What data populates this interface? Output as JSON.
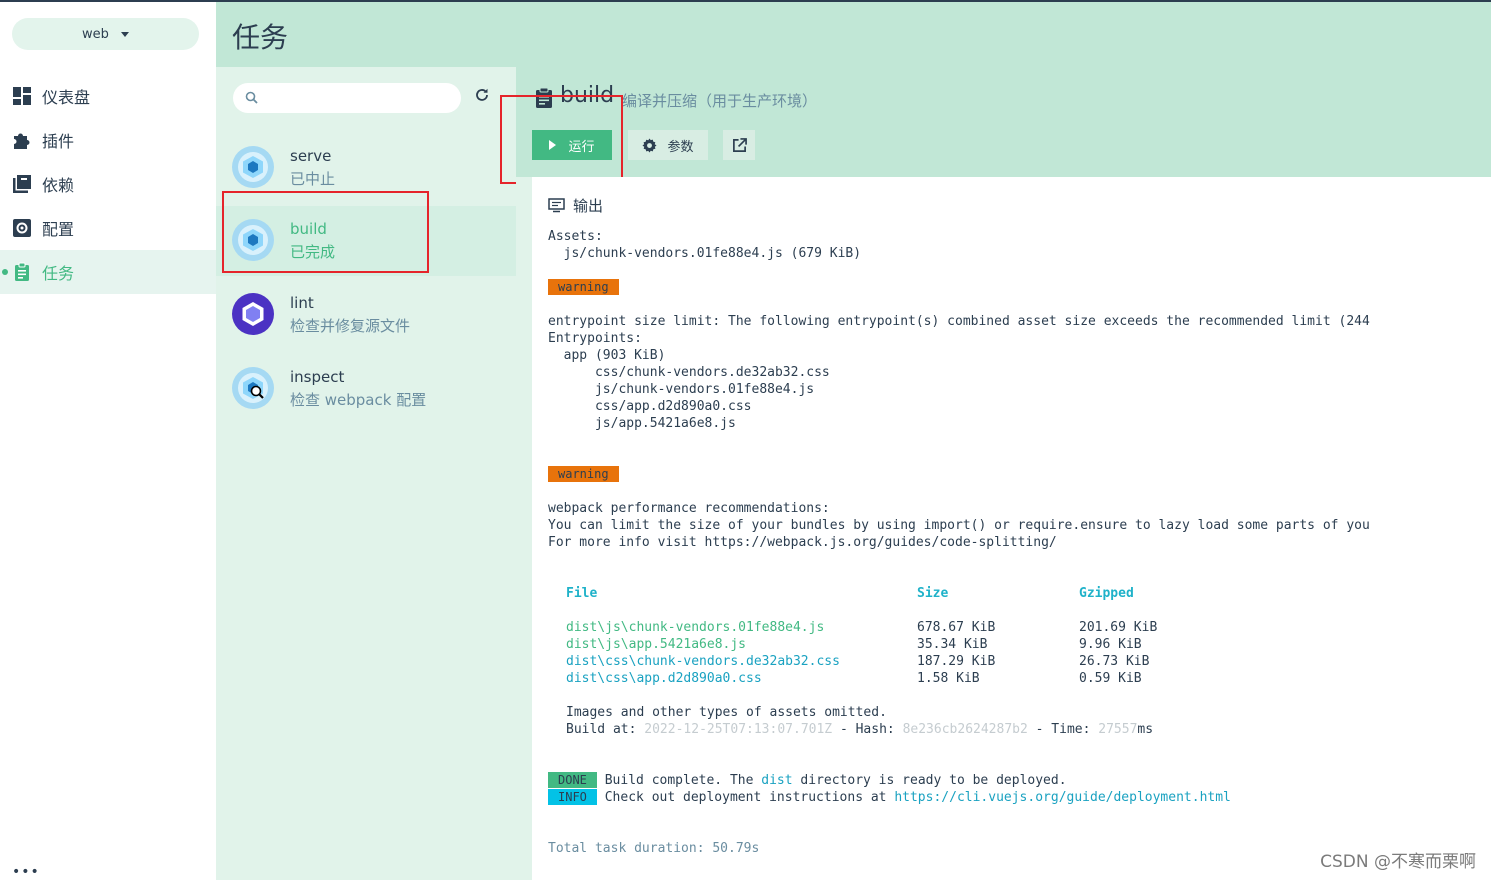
{
  "project": {
    "name": "web"
  },
  "nav": {
    "items": [
      {
        "label": "仪表盘",
        "icon": "dashboard-icon"
      },
      {
        "label": "插件",
        "icon": "puzzle-icon"
      },
      {
        "label": "依赖",
        "icon": "library-icon"
      },
      {
        "label": "配置",
        "icon": "settings-icon"
      },
      {
        "label": "任务",
        "icon": "clipboard-icon",
        "active": true
      }
    ],
    "more": "•••"
  },
  "header": {
    "title": "任务"
  },
  "search": {
    "placeholder": ""
  },
  "tasks": [
    {
      "name": "serve",
      "description": "已中止"
    },
    {
      "name": "build",
      "description": "已完成",
      "selected": true
    },
    {
      "name": "lint",
      "description": "检查并修复源文件"
    },
    {
      "name": "inspect",
      "description": "检查 webpack 配置"
    }
  ],
  "detail": {
    "name": "build",
    "description": "编译并压缩（用于生产环境）",
    "run_label": "运行",
    "params_label": "参数",
    "output_title": "输出"
  },
  "log": {
    "assets": "Assets:\n  js/chunk-vendors.01fe88e4.js (679 KiB)",
    "warning1": "warning",
    "entrypoint": "entrypoint size limit: The following entrypoint(s) combined asset size exceeds the recommended limit (244\nEntrypoints:\n  app (903 KiB)\n      css/chunk-vendors.de32ab32.css\n      js/chunk-vendors.01fe88e4.js\n      css/app.d2d890a0.css\n      js/app.5421a6e8.js",
    "warning2": "warning",
    "perf": "webpack performance recommendations:\nYou can limit the size of your bundles by using import() or require.ensure to lazy load some parts of you\nFor more info visit https://webpack.js.org/guides/code-splitting/",
    "table": {
      "headers": [
        "File",
        "Size",
        "Gzipped"
      ],
      "rows": [
        {
          "file": "dist\\js\\chunk-vendors.01fe88e4.js",
          "size": "678.67 KiB",
          "gzip": "201.69 KiB",
          "kind": "js"
        },
        {
          "file": "dist\\js\\app.5421a6e8.js",
          "size": "35.34 KiB",
          "gzip": "9.96 KiB",
          "kind": "js"
        },
        {
          "file": "dist\\css\\chunk-vendors.de32ab32.css",
          "size": "187.29 KiB",
          "gzip": "26.73 KiB",
          "kind": "css"
        },
        {
          "file": "dist\\css\\app.d2d890a0.css",
          "size": "1.58 KiB",
          "gzip": "0.59 KiB",
          "kind": "css"
        }
      ]
    },
    "omitted": "Images and other types of assets omitted.",
    "build_at_label": "Build at: ",
    "build_at": "2022-12-25T07:13:07.701Z",
    "hash_label": " - Hash: ",
    "hash": "8e236cb2624287b2",
    "time_label": " - Time: ",
    "time": "27557",
    "time_unit": "ms",
    "done_badge": "DONE",
    "done_pre": "Build complete. The ",
    "done_dist": "dist",
    "done_post": " directory is ready to be deployed.",
    "info_badge": "INFO",
    "info_pre": "Check out deployment instructions at ",
    "info_url": "https://cli.vuejs.org/guide/deployment.html",
    "total": "Total task duration: 50.79s"
  },
  "watermark": "CSDN @不寒而栗啊",
  "colors": {
    "accent": "#42b983",
    "header_bg": "#c1e7d6",
    "highlight_box": "#e5242b",
    "warning": "#e8730b",
    "info": "#03c2e6"
  }
}
